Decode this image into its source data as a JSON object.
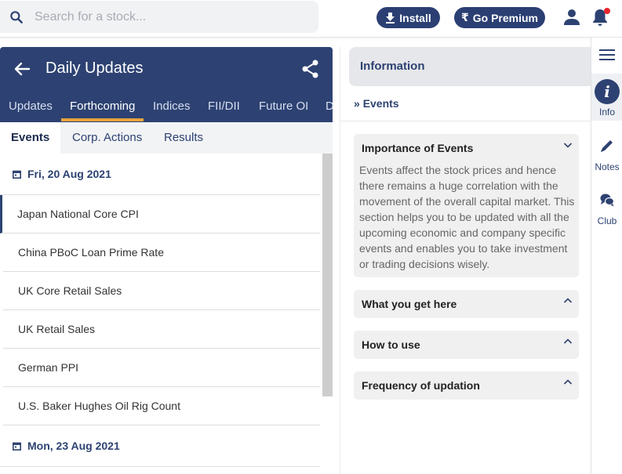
{
  "search": {
    "placeholder": "Search for a stock..."
  },
  "header": {
    "install_label": "Install",
    "premium_label": "Go Premium"
  },
  "panel": {
    "title": "Daily Updates",
    "tabs": [
      "Updates",
      "Forthcoming",
      "Indices",
      "FII/DII",
      "Future OI",
      "D"
    ],
    "active_tab": "Forthcoming",
    "subtabs": [
      "Events",
      "Corp. Actions",
      "Results"
    ],
    "active_subtab": "Events",
    "dates": [
      {
        "label": "Fri, 20 Aug 2021",
        "items": [
          "Japan National Core CPI",
          "China PBoC Loan Prime Rate",
          "UK Core Retail Sales",
          "UK Retail Sales",
          "German PPI",
          "U.S. Baker Hughes Oil Rig Count"
        ]
      },
      {
        "label": "Mon, 23 Aug 2021",
        "items": []
      }
    ]
  },
  "info": {
    "header": "Information",
    "breadcrumb_prefix": "»",
    "breadcrumb": "Events",
    "sections": [
      {
        "title": "Importance of Events",
        "expanded": true,
        "body": "Events affect the stock prices and hence there remains a huge correlation with the movement of the overall capital market. This section helps you to be updated with all the upcoming economic and company specific events and enables you to take investment or trading decisions wisely."
      },
      {
        "title": "What you get here",
        "expanded": false
      },
      {
        "title": "How to use",
        "expanded": false
      },
      {
        "title": "Frequency of updation",
        "expanded": false
      }
    ]
  },
  "rail": {
    "info_label": "Info",
    "notes_label": "Notes",
    "club_label": "Club"
  },
  "colors": {
    "primary": "#2d4272",
    "accent": "#e8a33c",
    "notification": "#e8262d"
  }
}
